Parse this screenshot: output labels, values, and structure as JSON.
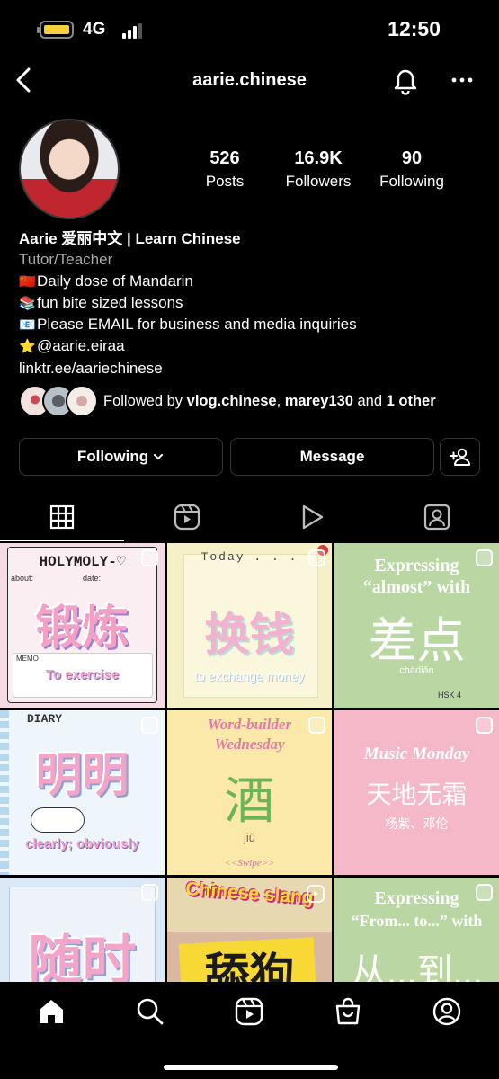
{
  "status_bar": {
    "network": "4G",
    "time": "12:50"
  },
  "header": {
    "username": "aarie.chinese"
  },
  "profile": {
    "stats": [
      {
        "value": "526",
        "label": "Posts"
      },
      {
        "value": "16.9K",
        "label": "Followers"
      },
      {
        "value": "90",
        "label": "Following"
      }
    ],
    "name": "Aarie 爱丽中文 | Learn Chinese",
    "category": "Tutor/Teacher",
    "bio_lines": [
      {
        "icon": "🇨🇳",
        "text": "Daily dose of Mandarin"
      },
      {
        "icon": "📚",
        "text": "fun bite sized lessons"
      },
      {
        "icon": "📧",
        "text": "Please EMAIL for business and media inquiries"
      },
      {
        "icon": "⭐",
        "text": "@aarie.eiraa"
      }
    ],
    "link": "linktr.ee/aariechinese",
    "followed_by": {
      "prefix": "Followed by ",
      "user1": "vlog.chinese",
      "sep": ", ",
      "user2": "marey130",
      "and": " and ",
      "others": "1 other"
    }
  },
  "actions": {
    "following": "Following",
    "message": "Message"
  },
  "posts": [
    {
      "title": "HOLYMOLY-♡",
      "sub1": "about:",
      "sub2": "date:",
      "hanzi": "锻炼",
      "memo": "MEMO",
      "english": "To exercise"
    },
    {
      "title": "Today . . .",
      "hanzi": "换钱",
      "english": "to exchange money"
    },
    {
      "title": "Expressing",
      "title2": "“almost” with",
      "hanzi": "差点",
      "pinyin": "chàdiǎn",
      "tag": "HSK 4"
    },
    {
      "title": "DIARY",
      "hanzi": "明明",
      "english": "clearly; obviously"
    },
    {
      "title": "Word-builder",
      "title2": "Wednesday",
      "hanzi": "酒",
      "pinyin": "jiǔ",
      "footer": "<<Swipe>>"
    },
    {
      "title": "Music Monday",
      "hanzi": "天地无霜",
      "sub": "杨紫、邓伦"
    },
    {
      "hanzi": "随时"
    },
    {
      "title": "Chinese slang",
      "hanzi": "舔狗"
    },
    {
      "title": "Expressing",
      "title2": "“From... to...” with",
      "hanzi": "从...到..."
    }
  ]
}
